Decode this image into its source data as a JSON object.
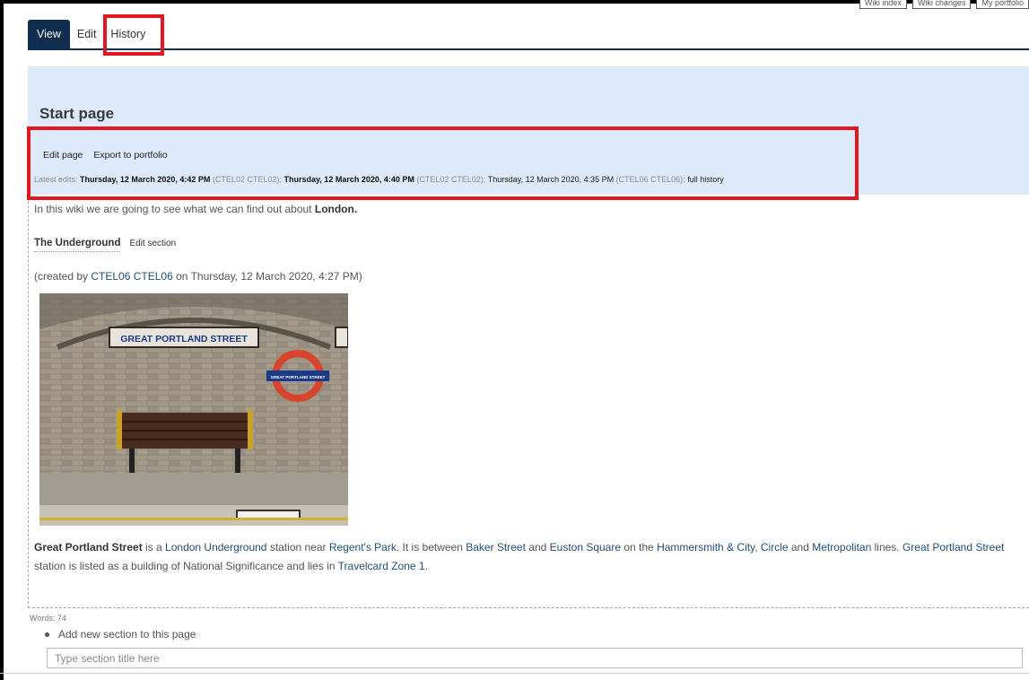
{
  "top_buttons": [
    "Wiki index",
    "Wiki changes",
    "My portfolio"
  ],
  "tabs": [
    {
      "label": "View",
      "active": true
    },
    {
      "label": "Edit",
      "active": false
    },
    {
      "label": "History",
      "active": false
    }
  ],
  "page": {
    "title": "Start page",
    "actions": [
      "Edit page",
      "Export to portfolio"
    ],
    "latest_edits": {
      "prefix": "Latest edits: ",
      "entries": [
        {
          "date": "Thursday, 12 March 2020, 4:42 PM",
          "user": " (CTEL02 CTEL02); "
        },
        {
          "date": "Thursday, 12 March 2020, 4:40 PM",
          "user": " (CTEL02 CTEL02); "
        },
        {
          "date": "Thursday, 12 March 2020, 4:35 PM",
          "user": " (CTEL06 CTEL06); "
        }
      ],
      "full_history": "full history"
    }
  },
  "intro": {
    "text": "In this wiki we are going to see what we can find out about ",
    "bold": "London."
  },
  "section": {
    "title": "The Underground",
    "edit_label": "Edit section",
    "created_prefix": "(created by ",
    "created_user": "CTEL06 CTEL06",
    "created_suffix": " on Thursday, 12 March 2020, 4:27 PM)"
  },
  "photo": {
    "sign_text": "GREAT PORTLAND STREET",
    "roundel_text": "GREAT PORTLAND STREET"
  },
  "paragraph": {
    "p1": "Great Portland Street",
    "p2": " is a ",
    "p3": "London Underground",
    "p4": " station near ",
    "p5": "Regent's Park",
    "p6": ". It is between ",
    "p7": "Baker Street",
    "p8": " and ",
    "p9": "Euston Square",
    "p10": " on the ",
    "p11": "Hammersmith & City",
    "p12": ", ",
    "p13": "Circle",
    "p14": " and ",
    "p15": "Metropolitan",
    "p16": " lines. ",
    "p17": "Great Portland Street",
    "p18": " station is listed as a building of National Significance and lies in ",
    "p19": "Travelcard Zone 1",
    "p20": "."
  },
  "words": "Words: 74",
  "add_section": {
    "label": "Add new section to this page",
    "placeholder": "Type section title here"
  },
  "colors": {
    "tab_active": "#0f2d4f",
    "banner": "#dceafb",
    "highlight": "#e2171f",
    "link": "#1f4e79"
  }
}
